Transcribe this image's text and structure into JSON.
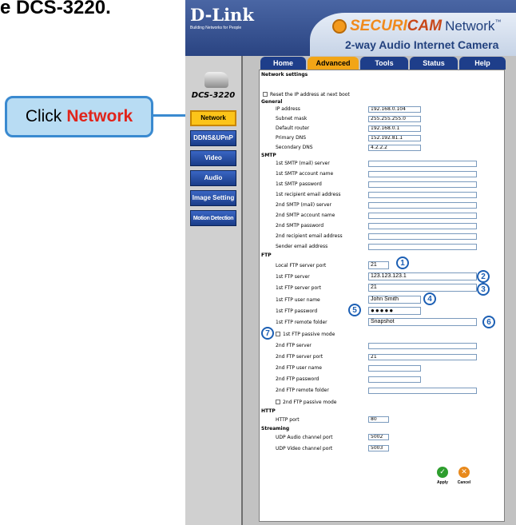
{
  "heading_fragment": "e DCS-3220.",
  "callout": {
    "prefix": "Click",
    "target": "Network"
  },
  "brand": {
    "logo": "D-Link",
    "tagline": "Building Networks for People",
    "product_part1": "SECURI",
    "product_part2": "CAM",
    "product_part3": "Network",
    "tm": "™",
    "subtitle": "2-way Audio Internet Camera"
  },
  "sidebar": {
    "model": "DCS-3220",
    "items": [
      {
        "label": "Network",
        "active": true
      },
      {
        "label": "DDNS&UPnP"
      },
      {
        "label": "Video"
      },
      {
        "label": "Audio"
      },
      {
        "label": "Image Setting"
      },
      {
        "label": "Motion Detection"
      }
    ]
  },
  "tabs": [
    {
      "label": "Home"
    },
    {
      "label": "Advanced",
      "active": true
    },
    {
      "label": "Tools"
    },
    {
      "label": "Status"
    },
    {
      "label": "Help"
    }
  ],
  "form": {
    "title": "Network settings",
    "reset_label": "Reset the IP address at next boot",
    "sections": {
      "general": "General",
      "smtp": "SMTP",
      "ftp": "FTP",
      "http": "HTTP",
      "streaming": "Streaming"
    },
    "general": [
      {
        "label": "IP address",
        "value": "192.168.0.104"
      },
      {
        "label": "Subnet mask",
        "value": "255.255.255.0"
      },
      {
        "label": "Default router",
        "value": "192.168.0.1"
      },
      {
        "label": "Primary DNS",
        "value": "152.192.81.1"
      },
      {
        "label": "Secondary DNS",
        "value": "4.2.2.2"
      }
    ],
    "smtp": [
      {
        "label": "1st SMTP (mail) server",
        "value": ""
      },
      {
        "label": "1st SMTP account name",
        "value": ""
      },
      {
        "label": "1st SMTP password",
        "value": ""
      },
      {
        "label": "1st recipient email address",
        "value": ""
      },
      {
        "label": "2nd SMTP (mail) server",
        "value": ""
      },
      {
        "label": "2nd SMTP account name",
        "value": ""
      },
      {
        "label": "2nd SMTP password",
        "value": ""
      },
      {
        "label": "2nd recipient email address",
        "value": ""
      },
      {
        "label": "Sender email address",
        "value": ""
      }
    ],
    "ftp": [
      {
        "label": "Local FTP server port",
        "value": "21",
        "marker": "1"
      },
      {
        "label": "1st FTP server",
        "value": "123.123.123.1",
        "marker": "2"
      },
      {
        "label": "1st FTP server port",
        "value": "21",
        "marker": "3"
      },
      {
        "label": "1st FTP user name",
        "value": "John Smith",
        "marker": "4"
      },
      {
        "label": "1st FTP password",
        "value": "●●●●●",
        "marker": "5"
      },
      {
        "label": "1st FTP remote folder",
        "value": "Snapshot",
        "marker": "6"
      }
    ],
    "ftp_passive_1": {
      "label": "1st FTP passive mode",
      "marker": "7"
    },
    "ftp2": [
      {
        "label": "2nd FTP server",
        "value": ""
      },
      {
        "label": "2nd FTP server port",
        "value": "21"
      },
      {
        "label": "2nd FTP user name",
        "value": ""
      },
      {
        "label": "2nd FTP password",
        "value": ""
      },
      {
        "label": "2nd FTP remote folder",
        "value": ""
      }
    ],
    "ftp_passive_2": {
      "label": "2nd FTP passive mode"
    },
    "http": [
      {
        "label": "HTTP port",
        "value": "80"
      }
    ],
    "streaming": [
      {
        "label": "UDP Audio channel port",
        "value": "5002"
      },
      {
        "label": "UDP Video channel port",
        "value": "5003"
      }
    ],
    "buttons": {
      "apply": "Apply",
      "cancel": "Cancel"
    }
  },
  "colors": {
    "header_blue": "#2a4482",
    "tab_blue": "#1e3e8a",
    "active_tab": "#f2a516",
    "active_nav": "#fcc419",
    "callout_fill": "#b8dcf3",
    "callout_border": "#3a8ad0",
    "highlight_red": "#e0241b",
    "marker_blue": "#1c5fb4",
    "apply_green": "#2e9e2e",
    "cancel_orange": "#e8891c"
  },
  "icons": {
    "camera_badge": "camera-badge-icon",
    "camera": "camera-icon",
    "apply": "checkmark-icon",
    "cancel": "x-icon"
  }
}
